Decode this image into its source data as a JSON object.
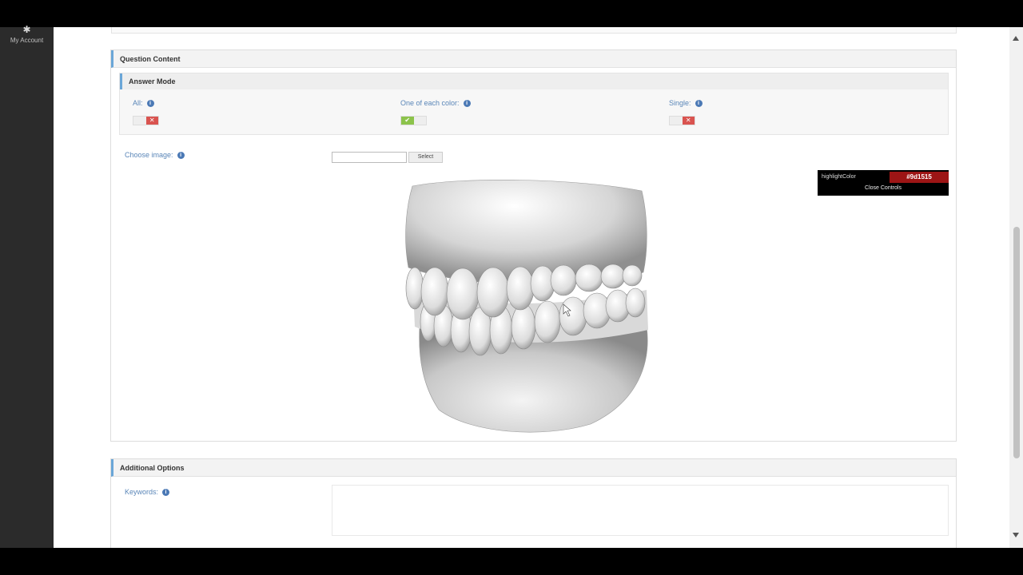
{
  "sidebar": {
    "account_label": "My Account",
    "account_icon": "gear-icon"
  },
  "question_content": {
    "title": "Question Content",
    "answer_mode": {
      "title": "Answer Mode",
      "options": [
        {
          "label": "All:",
          "state": "off"
        },
        {
          "label": "One of each color:",
          "state": "on"
        },
        {
          "label": "Single:",
          "state": "off"
        }
      ]
    },
    "choose_image": {
      "label": "Choose image:",
      "input_value": "",
      "select_label": "Select"
    },
    "viewer": {
      "control_key": "highlightColor",
      "control_value": "#9d1515",
      "close_label": "Close Controls"
    }
  },
  "additional_options": {
    "title": "Additional Options",
    "keywords_label": "Keywords:",
    "keywords_value": ""
  },
  "glyphs": {
    "info": "i",
    "check": "✔",
    "cross": "✕"
  }
}
